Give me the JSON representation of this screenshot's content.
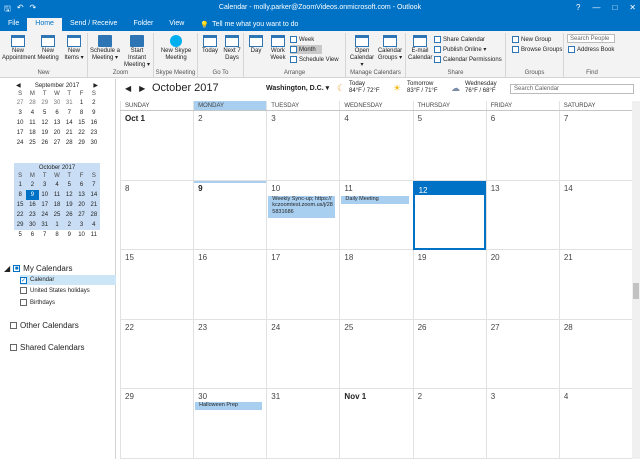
{
  "window": {
    "title": "Calendar - molly.parker@ZoomVideos.onmicrosoft.com - Outlook",
    "quick_access": [
      "🖫",
      "↶",
      "↷"
    ],
    "controls": [
      "?",
      "—",
      "□",
      "✕"
    ]
  },
  "tabs": [
    "File",
    "Home",
    "Send / Receive",
    "Folder",
    "View"
  ],
  "tell_me": "Tell me what you want to do",
  "ribbon": {
    "groups": {
      "new": "New",
      "zoom": "Zoom",
      "skype": "Skype Meeting",
      "goto": "Go To",
      "arrange": "Arrange",
      "manage": "Manage Calendars",
      "share": "Share",
      "groups": "Groups",
      "find": "Find"
    },
    "new_appointment": "New Appointment",
    "new_meeting": "New Meeting",
    "new_items": "New Items ▾",
    "schedule_meeting": "Schedule a Meeting ▾",
    "start_instant": "Start Instant Meeting ▾",
    "new_skype": "New Skype Meeting",
    "today": "Today",
    "next7": "Next 7 Days",
    "day": "Day",
    "work_week": "Work Week",
    "week": "Week",
    "month": "Month",
    "schedule_view": "Schedule View",
    "open_calendar": "Open Calendar ▾",
    "calendar_groups": "Calendar Groups ▾",
    "email_calendar": "E-mail Calendar",
    "share_calendar": "Share Calendar",
    "publish_online": "Publish Online ▾",
    "calendar_permissions": "Calendar Permissions",
    "new_group": "New Group",
    "browse_groups": "Browse Groups",
    "search_people": "Search People",
    "address_book": "Address Book"
  },
  "mini_calendars": [
    {
      "title": "September 2017",
      "dow": [
        "S",
        "M",
        "T",
        "W",
        "T",
        "F",
        "S"
      ],
      "weeks": [
        [
          "27",
          "28",
          "29",
          "30",
          "31",
          "1",
          "2"
        ],
        [
          "3",
          "4",
          "5",
          "6",
          "7",
          "8",
          "9"
        ],
        [
          "10",
          "11",
          "12",
          "13",
          "14",
          "15",
          "16"
        ],
        [
          "17",
          "18",
          "19",
          "20",
          "21",
          "22",
          "23"
        ],
        [
          "24",
          "25",
          "26",
          "27",
          "28",
          "29",
          "30"
        ]
      ]
    },
    {
      "title": "October 2017",
      "dow": [
        "S",
        "M",
        "T",
        "W",
        "T",
        "F",
        "S"
      ],
      "weeks": [
        [
          "1",
          "2",
          "3",
          "4",
          "5",
          "6",
          "7"
        ],
        [
          "8",
          "9",
          "10",
          "11",
          "12",
          "13",
          "14"
        ],
        [
          "15",
          "16",
          "17",
          "18",
          "19",
          "20",
          "21"
        ],
        [
          "22",
          "23",
          "24",
          "25",
          "26",
          "27",
          "28"
        ],
        [
          "29",
          "30",
          "31",
          "1",
          "2",
          "3",
          "4"
        ],
        [
          "5",
          "6",
          "7",
          "8",
          "9",
          "10",
          "11"
        ]
      ]
    }
  ],
  "folders": {
    "my_calendars": "My Calendars",
    "calendar": "Calendar",
    "us_holidays": "United States holidays",
    "birthdays": "Birthdays",
    "other_calendars": "Other Calendars",
    "shared_calendars": "Shared Calendars"
  },
  "calendar": {
    "month_title": "October 2017",
    "location": "Washington, D.C. ▾",
    "weather": [
      {
        "day": "Today",
        "temp": "84°F / 72°F",
        "icon": "☾"
      },
      {
        "day": "Tomorrow",
        "temp": "83°F / 71°F",
        "icon": "☀"
      },
      {
        "day": "Wednesday",
        "temp": "76°F / 68°F",
        "icon": "☁"
      }
    ],
    "search_placeholder": "Search Calendar",
    "days_of_week": [
      "SUNDAY",
      "MONDAY",
      "TUESDAY",
      "WEDNESDAY",
      "THURSDAY",
      "FRIDAY",
      "SATURDAY"
    ],
    "weeks": [
      [
        "Oct 1",
        "2",
        "3",
        "4",
        "5",
        "6",
        "7"
      ],
      [
        "8",
        "9",
        "10",
        "11",
        "12",
        "13",
        "14"
      ],
      [
        "15",
        "16",
        "17",
        "18",
        "19",
        "20",
        "21"
      ],
      [
        "22",
        "23",
        "24",
        "25",
        "26",
        "27",
        "28"
      ],
      [
        "29",
        "30",
        "31",
        "Nov 1",
        "2",
        "3",
        "4"
      ]
    ],
    "events": [
      {
        "title": "Weekly Sync-up; https://kczoomtest.zoom.us/j/285831686"
      },
      {
        "title": "Daily Meeting"
      },
      {
        "title": "Halloween Prep"
      }
    ]
  }
}
